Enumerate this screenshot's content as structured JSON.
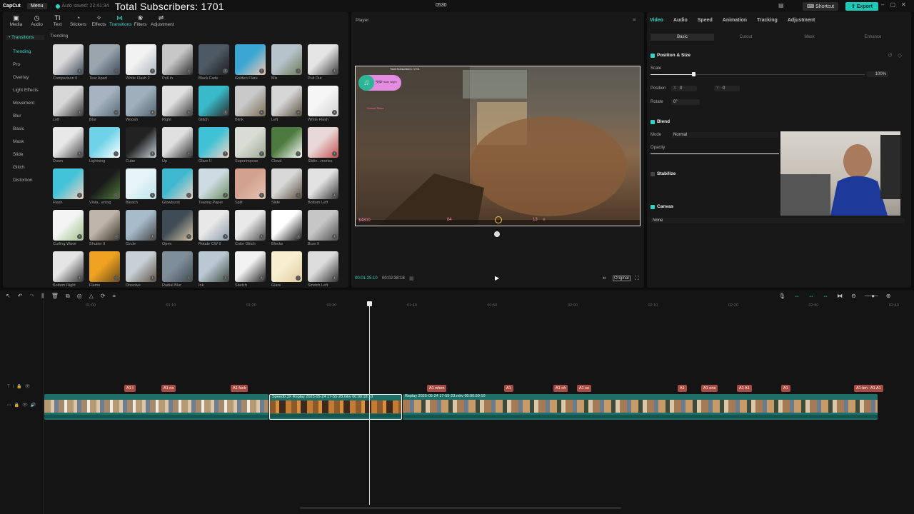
{
  "topbar": {
    "logo": "CapCut",
    "menu": "Menu",
    "autosave": "Auto saved: 22:41:34",
    "overlay_title": "Total Subscribers: 1701",
    "project_name": "0530",
    "shortcut": "Shortcut",
    "export": "Export"
  },
  "tools": [
    {
      "label": "Media",
      "icon": "▣"
    },
    {
      "label": "Audio",
      "icon": "◷"
    },
    {
      "label": "Text",
      "icon": "TI"
    },
    {
      "label": "Stickers",
      "icon": "◔"
    },
    {
      "label": "Effects",
      "icon": "✧"
    },
    {
      "label": "Transitions",
      "icon": "⋈"
    },
    {
      "label": "Filters",
      "icon": "❀"
    },
    {
      "label": "Adjustment",
      "icon": "⇌"
    }
  ],
  "categories": {
    "header": "• Transitions",
    "items": [
      "Trending",
      "Pro",
      "Overlay",
      "Light Effects",
      "Movement",
      "Blur",
      "Basic",
      "Mask",
      "Slide",
      "Glitch",
      "Distortion"
    ]
  },
  "grid_heading": "Trending",
  "transitions": [
    {
      "label": "Comparison II",
      "c1": "#d9d9d9",
      "c2": "#3b4a5a"
    },
    {
      "label": "Tear Apart",
      "c1": "#9aa5ae",
      "c2": "#3e4d5b"
    },
    {
      "label": "White Flash 2",
      "c1": "#f2f2f2",
      "c2": "#aeb6bd"
    },
    {
      "label": "Pull in",
      "c1": "#c7c7c7",
      "c2": "#2d2d2d"
    },
    {
      "label": "Black Fade",
      "c1": "#4e5a63",
      "c2": "#1c1c1c"
    },
    {
      "label": "Golden Flare",
      "c1": "#3aa6d4",
      "c2": "#f1c7b0"
    },
    {
      "label": "Mix",
      "c1": "#b7c3cb",
      "c2": "#6b7a5a"
    },
    {
      "label": "Pull Out",
      "c1": "#e5e5e5",
      "c2": "#3b3b3b"
    },
    {
      "label": "Left",
      "c1": "#d8d8d8",
      "c2": "#333"
    },
    {
      "label": "Blur",
      "c1": "#a5b4c0",
      "c2": "#596b78"
    },
    {
      "label": "Woosh",
      "c1": "#9fb0bc",
      "c2": "#536270"
    },
    {
      "label": "Right",
      "c1": "#e0e0e0",
      "c2": "#3a3a3a"
    },
    {
      "label": "Glitch",
      "c1": "#39b9c9",
      "c2": "#2a2a2a"
    },
    {
      "label": "Blink",
      "c1": "#c8c8c8",
      "c2": "#7a6e54"
    },
    {
      "label": "Left",
      "c1": "#d6d6d6",
      "c2": "#5a4f3e"
    },
    {
      "label": "White Flash",
      "c1": "#f6f6f6",
      "c2": "#d0d0d0"
    },
    {
      "label": "Down",
      "c1": "#e8e8e8",
      "c2": "#444"
    },
    {
      "label": "Lightning",
      "c1": "#6fd3e8",
      "c2": "#ffffff"
    },
    {
      "label": "Cube",
      "c1": "#222",
      "c2": "#c9d3d9"
    },
    {
      "label": "Up",
      "c1": "#e0e0e0",
      "c2": "#2f2f2f"
    },
    {
      "label": "Glare II",
      "c1": "#40c2d6",
      "c2": "#f3d2c2"
    },
    {
      "label": "Superimpose",
      "c1": "#d8dcd5",
      "c2": "#9aa890"
    },
    {
      "label": "Cloud",
      "c1": "#4d7a3e",
      "c2": "#ffffff"
    },
    {
      "label": "Slidin...mories",
      "c1": "#e7d7d7",
      "c2": "#c94d4d"
    },
    {
      "label": "Flash",
      "c1": "#43c3d7",
      "c2": "#f5d0c0"
    },
    {
      "label": "Vinta...ening",
      "c1": "#1a1a1a",
      "c2": "#4f7a3a"
    },
    {
      "label": "Bleach",
      "c1": "#e6f4f7",
      "c2": "#bce3ec"
    },
    {
      "label": "Glowburst",
      "c1": "#3eb8cf",
      "c2": "#f0d3c6"
    },
    {
      "label": "Tearing Paper",
      "c1": "#cfdbe3",
      "c2": "#6a8a60"
    },
    {
      "label": "Split",
      "c1": "#d3a28f",
      "c2": "#e7c3b3"
    },
    {
      "label": "Slide",
      "c1": "#d8d8d8",
      "c2": "#574b3a"
    },
    {
      "label": "Bottom Left",
      "c1": "#e2e2e2",
      "c2": "#363636"
    },
    {
      "label": "Curling Wave",
      "c1": "#f4f4f4",
      "c2": "#9fbf8a"
    },
    {
      "label": "Shutter II",
      "c1": "#bfb5a8",
      "c2": "#3b332a"
    },
    {
      "label": "Circle",
      "c1": "#a7bccb",
      "c2": "#444"
    },
    {
      "label": "Open",
      "c1": "#3f4b55",
      "c2": "#d8c6a5"
    },
    {
      "label": "Rotate CW II",
      "c1": "#e8e8e8",
      "c2": "#8a9aa8"
    },
    {
      "label": "Color Glitch",
      "c1": "#e9e9e9",
      "c2": "#4a4a4a"
    },
    {
      "label": "Blocks",
      "c1": "#ffffff",
      "c2": "#111"
    },
    {
      "label": "Burn II",
      "c1": "#c6c6c6",
      "c2": "#4d4d4d"
    },
    {
      "label": "Bottom Right",
      "c1": "#e5e5e5",
      "c2": "#333"
    },
    {
      "label": "Flame",
      "c1": "#f0a321",
      "c2": "#6a4a18"
    },
    {
      "label": "Dissolve",
      "c1": "#c9d0d5",
      "c2": "#5d5446"
    },
    {
      "label": "Radial Blur",
      "c1": "#7f8f99",
      "c2": "#3f4b53"
    },
    {
      "label": "Ink",
      "c1": "#b9c8d3",
      "c2": "#3b4b40"
    },
    {
      "label": "Sketch",
      "c1": "#f2f2f2",
      "c2": "#222"
    },
    {
      "label": "Glare",
      "c1": "#f7efd0",
      "c2": "#e2c99d"
    },
    {
      "label": "Stretch Left",
      "c1": "#dcdcdc",
      "c2": "#2e2e2e"
    }
  ],
  "player": {
    "title": "Player",
    "time_current": "00:01:25:10",
    "time_total": "00:02:38:18",
    "original": "Original",
    "game": {
      "subs": "Total Subscribers: 1701",
      "stream_tag": "夜蝶Friday Night",
      "stream_sub": "Sunset Skies",
      "money": "$4800",
      "health": "84",
      "ammo": "13",
      "ammo_reserve": "≡"
    }
  },
  "props": {
    "tabs": [
      "Video",
      "Audio",
      "Speed",
      "Animation",
      "Tracking",
      "Adjustment"
    ],
    "subtabs": [
      "Basic",
      "Cutout",
      "Mask",
      "Enhance"
    ],
    "position_size": "Position & Size",
    "scale_label": "Scale",
    "scale_value": "100%",
    "scale_fraction": 0.2,
    "position_label": "Position",
    "x_label": "X",
    "x_value": "0",
    "y_label": "Y",
    "y_value": "0",
    "rotate_label": "Rotate",
    "rotate_value": "0°",
    "blend": "Blend",
    "mode_label": "Mode",
    "mode_value": "Normal",
    "opacity_label": "Opacity",
    "stabilize": "Stabilize",
    "canvas": "Canvas",
    "canvas_value": "None"
  },
  "timeline": {
    "ticks": [
      "01:00",
      "01:10",
      "01:20",
      "01:30",
      "01:40",
      "01:50",
      "02:00",
      "02:10",
      "02:20",
      "02:30",
      "02:40"
    ],
    "captions": [
      "A1 I",
      "A1 no",
      "A1 fuck",
      "A1 when",
      "A1",
      "A1 oh",
      "A1 so",
      "A1",
      "A1 one",
      "A1 A1",
      "A1",
      "A1 ten",
      "A1 A1"
    ],
    "clip1_label": "",
    "clip2_label": "Speed0.3X  Replay 2025-05-24 17-55-28.mkv  00:00:18:10",
    "clip3_label": "Replay 2025-05-24 17-55-23.mkv  00:00:59:10"
  }
}
